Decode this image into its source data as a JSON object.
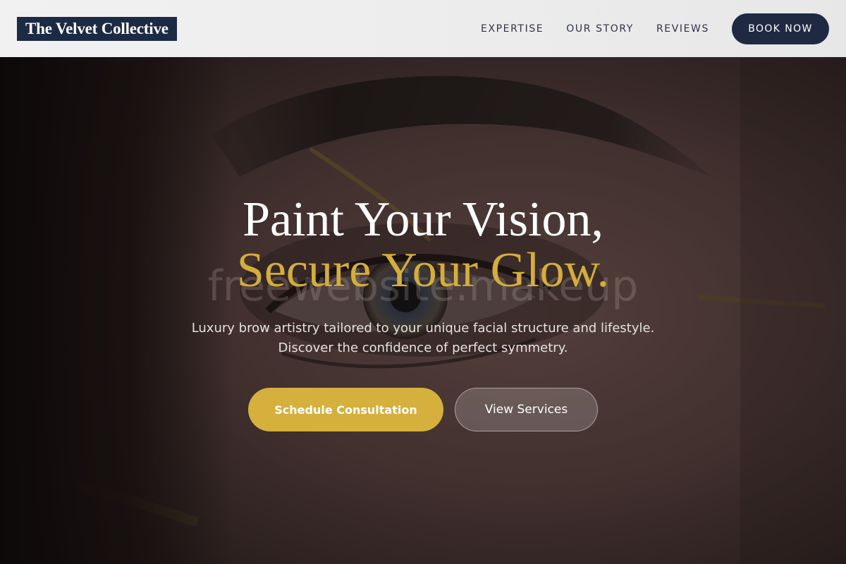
{
  "header": {
    "logo_text": "The Velvet Collective",
    "nav": [
      {
        "label": "EXPERTISE"
      },
      {
        "label": "OUR STORY"
      },
      {
        "label": "REVIEWS"
      }
    ],
    "book_label": "BOOK NOW"
  },
  "hero": {
    "headline_line1": "Paint Your Vision,",
    "headline_line2": "Secure Your Glow.",
    "watermark": "freewebsite.makeup",
    "subtext_line1": "Luxury brow artistry tailored to your unique facial structure and lifestyle.",
    "subtext_line2": "Discover the confidence of perfect symmetry.",
    "primary_cta": "Schedule Consultation",
    "secondary_cta": "View Services"
  },
  "colors": {
    "navy": "#1f2a42",
    "gold": "#d4ad3b",
    "header_bg": "#efefef"
  }
}
